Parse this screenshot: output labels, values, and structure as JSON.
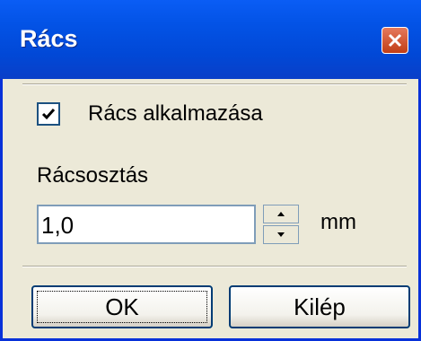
{
  "window": {
    "title": "Rács"
  },
  "checkbox": {
    "label": "Rács alkalmazása",
    "checked": true
  },
  "grid_spacing": {
    "label": "Rácsosztás",
    "value": "1,0",
    "unit": "mm"
  },
  "buttons": {
    "ok_label": "OK",
    "cancel_label": "Kilép"
  },
  "icons": {
    "close": "close-icon",
    "spin_up": "arrow-up-icon",
    "spin_down": "arrow-down-icon",
    "check": "checkmark-icon"
  },
  "colors": {
    "titlebar": "#0353e6",
    "window_bg": "#ece9d8",
    "close_button": "#d4552f"
  }
}
